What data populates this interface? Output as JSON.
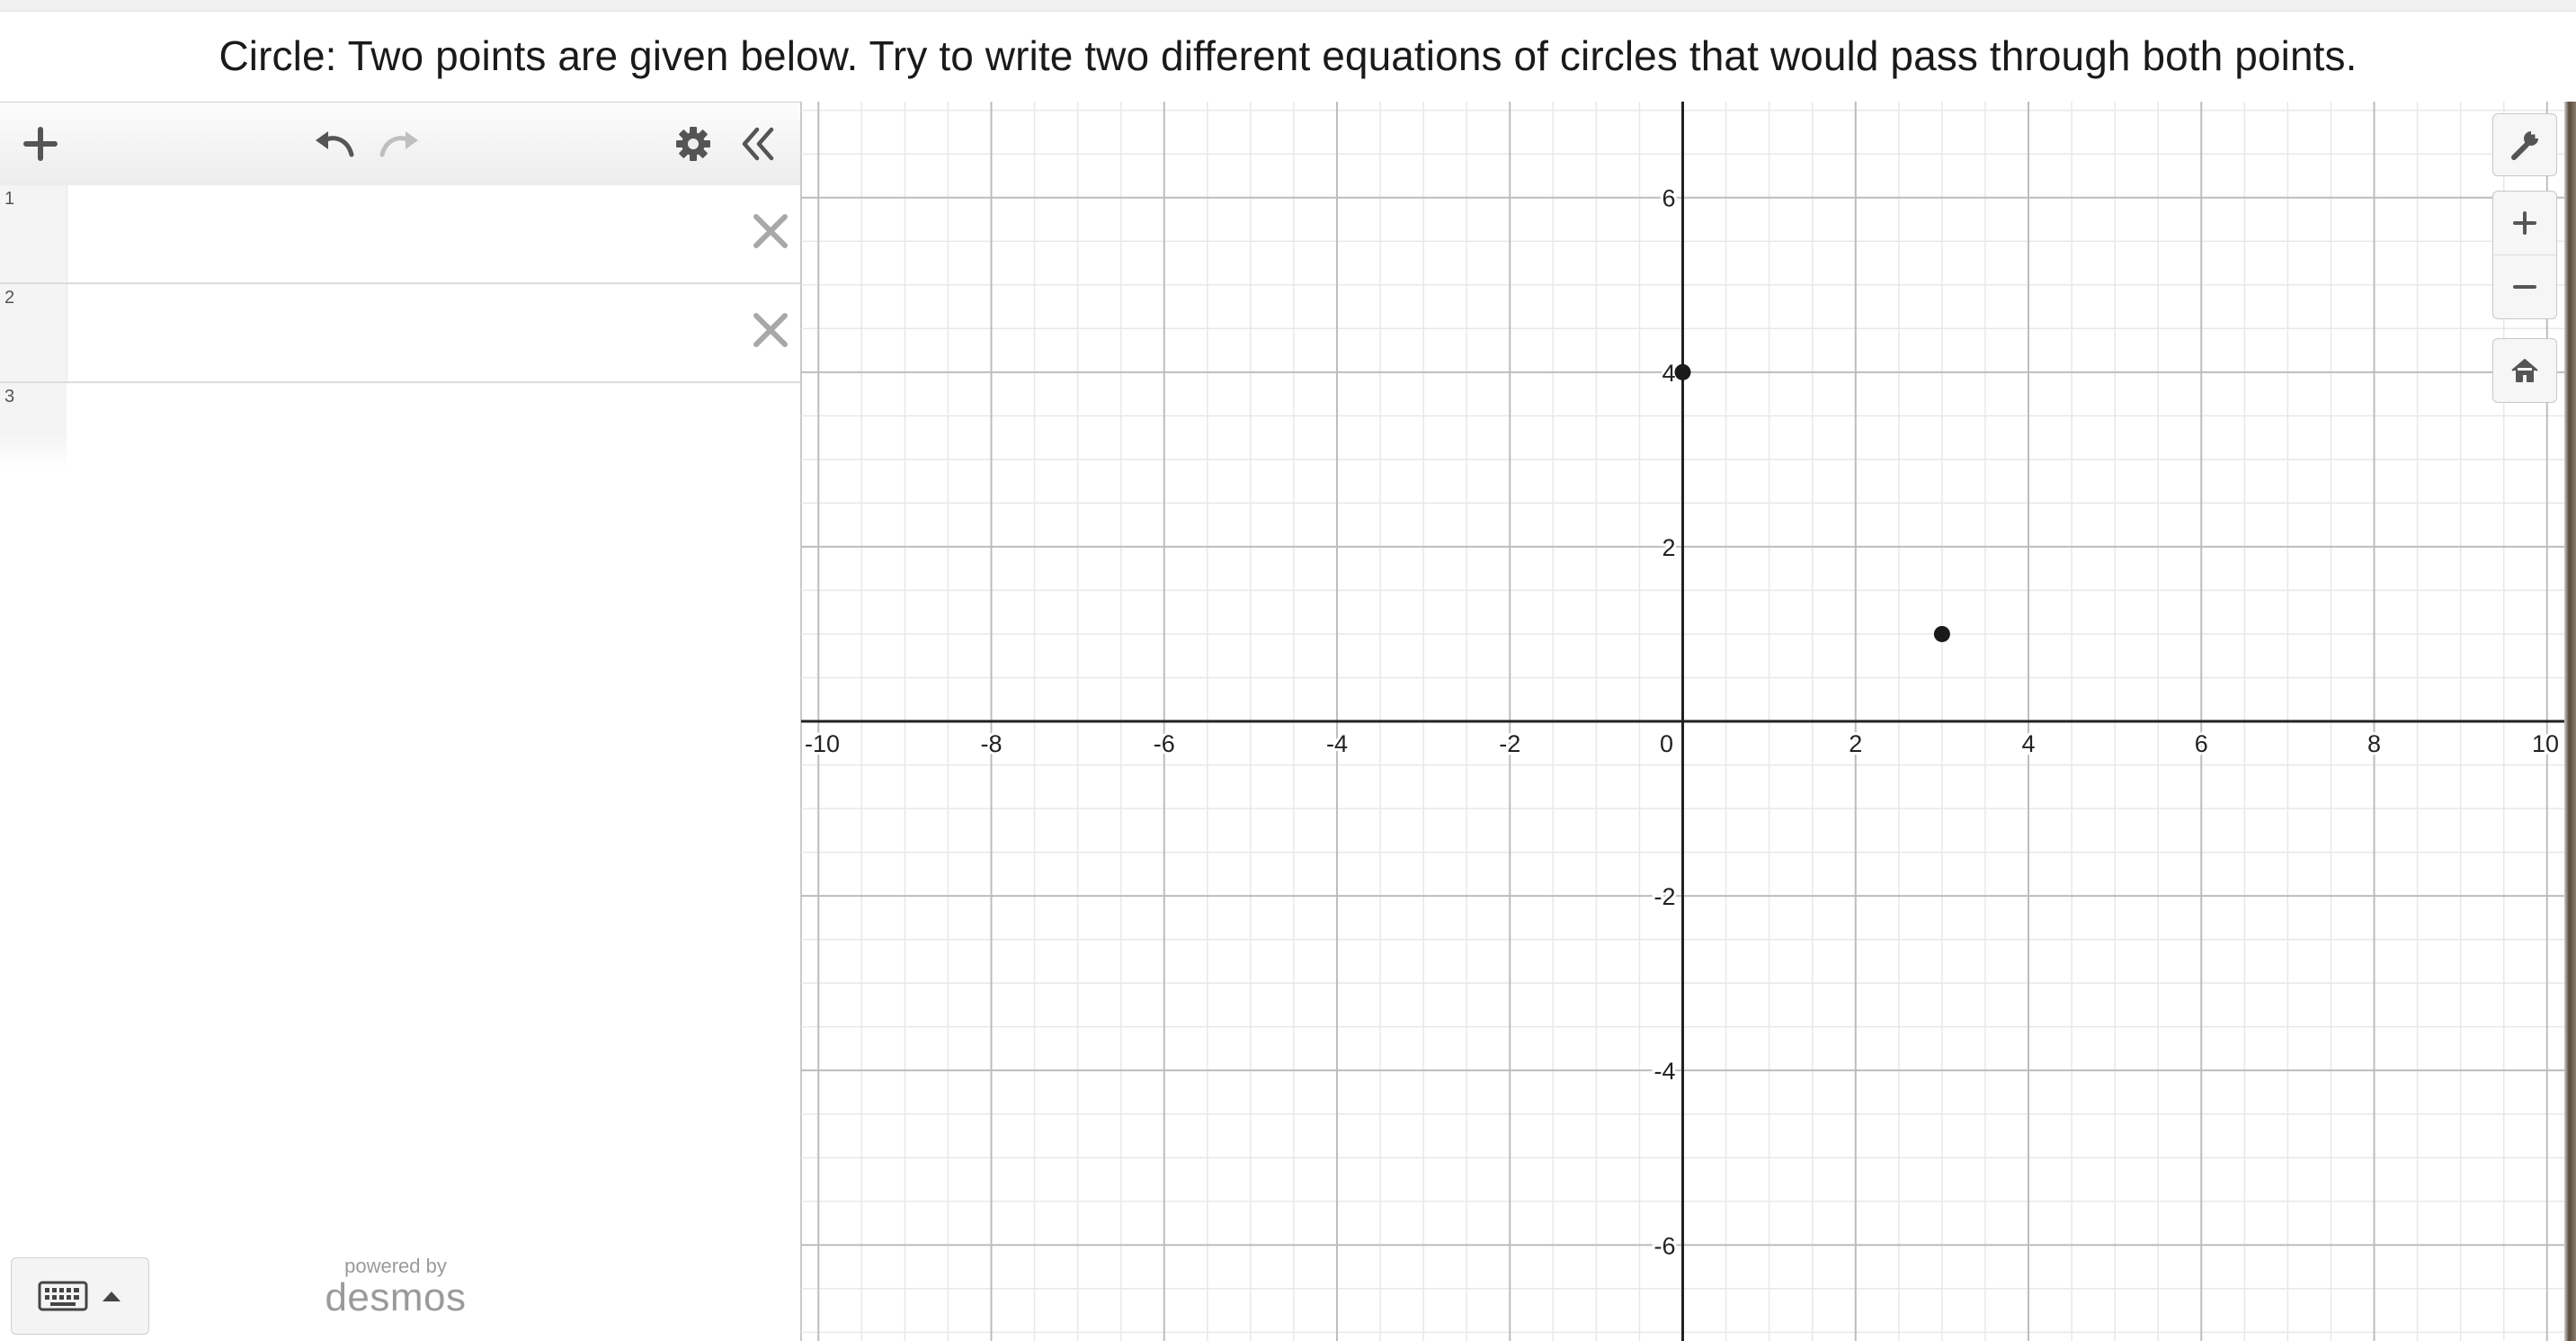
{
  "header": {
    "title": "Circle: Two points are given below. Try to write two different equations of circles that would pass through both points."
  },
  "expressions": {
    "rows": [
      {
        "number": "1",
        "value": ""
      },
      {
        "number": "2",
        "value": ""
      },
      {
        "number": "3",
        "value": ""
      }
    ]
  },
  "footer": {
    "powered_by": "powered by",
    "brand": "desmos"
  },
  "icons": {
    "add": "plus-icon",
    "undo": "undo-icon",
    "redo": "redo-icon",
    "settings": "gear-icon",
    "collapse": "double-chevron-left-icon",
    "delete": "close-icon",
    "keyboard": "keyboard-icon",
    "wrench": "wrench-icon",
    "zoom_in": "plus-icon",
    "zoom_out": "minus-icon",
    "home": "home-icon"
  },
  "colors": {
    "point": "#1a1a1a",
    "axis": "#222222",
    "major_grid": "#bdbdbd",
    "minor_grid": "#e8e8e8",
    "toolbar_icon": "#555555",
    "disabled_icon": "#bfbfbf"
  },
  "chart_data": {
    "type": "scatter",
    "title": "",
    "xlabel": "",
    "ylabel": "",
    "xlim": [
      -10.2,
      10.2
    ],
    "ylim": [
      -7.1,
      7.1
    ],
    "x_ticks": [
      "-10",
      "-8",
      "-6",
      "-4",
      "-2",
      "0",
      "2",
      "4",
      "6",
      "8",
      "10"
    ],
    "y_ticks": [
      "-6",
      "-4",
      "-2",
      "2",
      "4",
      "6"
    ],
    "grid": true,
    "series": [
      {
        "points": [
          {
            "x": 0,
            "y": 4
          },
          {
            "x": 3,
            "y": 1
          }
        ]
      }
    ]
  }
}
